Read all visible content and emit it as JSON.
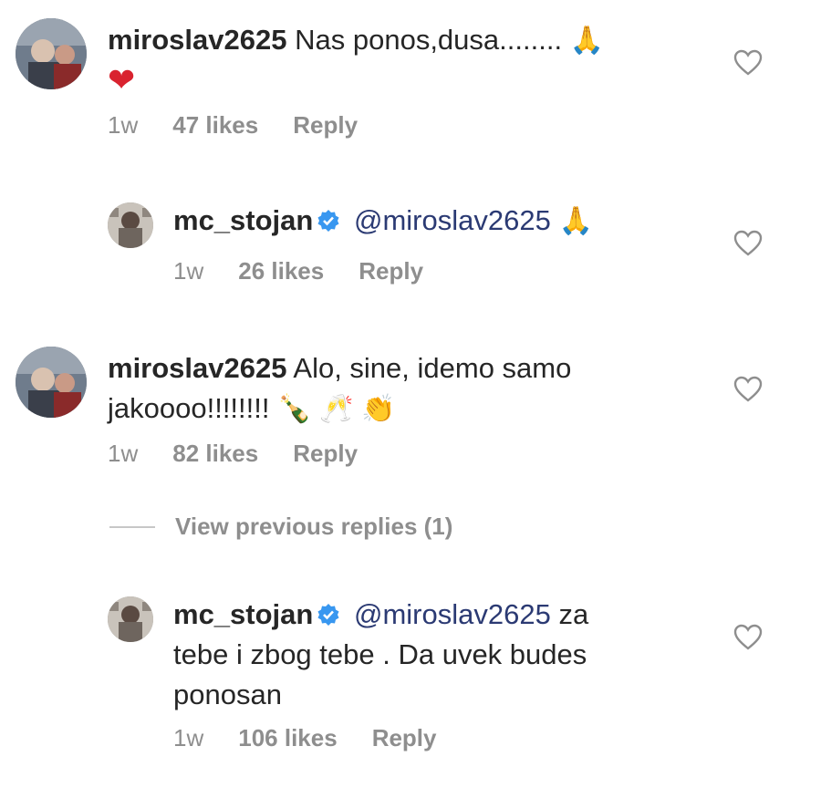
{
  "comments": [
    {
      "username": "miroslav2625",
      "line1": "Nas ponos,dusa........",
      "emoji1": "🙏",
      "line2_emoji": "❤",
      "time": "1w",
      "likes": "47 likes",
      "reply": "Reply"
    },
    {
      "username": "mc_stojan",
      "mention": "@miroslav2625",
      "emoji": "🙏",
      "time": "1w",
      "likes": "26 likes",
      "reply": "Reply"
    },
    {
      "username": "miroslav2625",
      "line1": "Alo, sine, idemo samo",
      "line2": "jakoooo!!!!!!!!",
      "emoji_bottle": "🍾",
      "emoji_glasses": "🥂",
      "emoji_clap": "👏",
      "time": "1w",
      "likes": "82 likes",
      "reply": "Reply"
    },
    {
      "username": "mc_stojan",
      "mention": "@miroslav2625",
      "line1_tail": "za",
      "line2": "tebe i zbog tebe . Da uvek budes",
      "line3": "ponosan",
      "time": "1w",
      "likes": "106 likes",
      "reply": "Reply"
    }
  ],
  "view_previous_replies": "View previous replies (1)",
  "colors": {
    "text": "#262626",
    "meta": "#8e8e8e",
    "mention": "#2b3a73",
    "verified": "#3897f0"
  }
}
